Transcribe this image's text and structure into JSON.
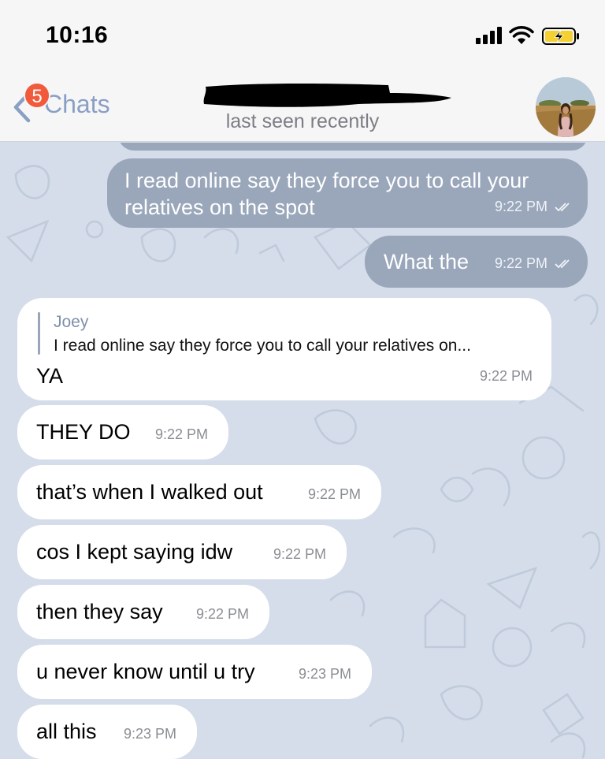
{
  "status_bar": {
    "time": "10:16",
    "icons": [
      "signal-icon",
      "wifi-icon",
      "battery-charging-icon"
    ]
  },
  "header": {
    "back_label": "Chats",
    "unread_badge": "5",
    "subtitle": "last seen recently",
    "avatar": "contact-avatar"
  },
  "colors": {
    "outgoing_bubble": "#9aa7bb",
    "incoming_bubble": "#ffffff",
    "chat_background": "#d4dde9",
    "accent": "#8a9fc4",
    "badge": "#f15a3a"
  },
  "messages": [
    {
      "direction": "out",
      "text_lines": [
        "I read online say they force you to call your",
        "relatives on the spot"
      ],
      "time": "9:22 PM",
      "status": "read"
    },
    {
      "direction": "out",
      "text_lines": [
        "What the"
      ],
      "time": "9:22 PM",
      "status": "read"
    },
    {
      "direction": "in",
      "reply_to": {
        "author": "Joey",
        "text": "I read online say they force you to call your relatives on..."
      },
      "text_lines": [
        "YA"
      ],
      "time": "9:22 PM"
    },
    {
      "direction": "in",
      "text_lines": [
        "THEY DO"
      ],
      "time": "9:22 PM"
    },
    {
      "direction": "in",
      "text_lines": [
        "that’s when I walked out"
      ],
      "time": "9:22 PM"
    },
    {
      "direction": "in",
      "text_lines": [
        "cos I kept saying idw"
      ],
      "time": "9:22 PM"
    },
    {
      "direction": "in",
      "text_lines": [
        "then they say"
      ],
      "time": "9:22 PM"
    },
    {
      "direction": "in",
      "text_lines": [
        "u never know until u try"
      ],
      "time": "9:23 PM"
    },
    {
      "direction": "in",
      "text_lines": [
        "all this"
      ],
      "time": "9:23 PM"
    }
  ]
}
